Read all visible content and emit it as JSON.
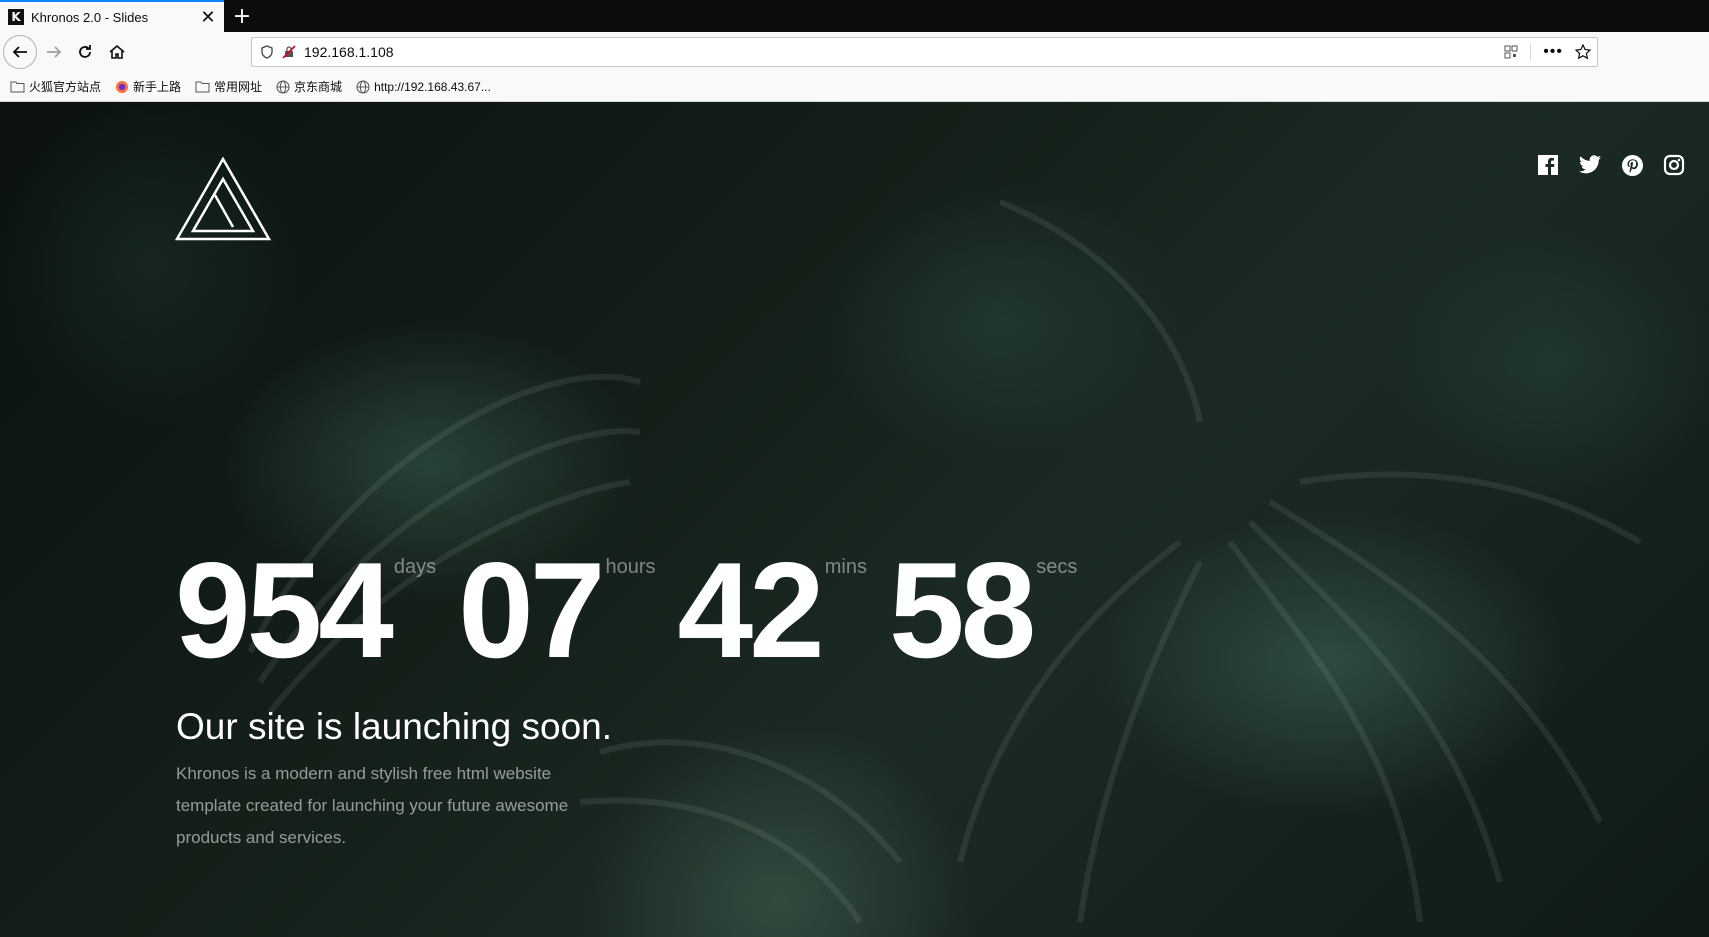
{
  "browser": {
    "tab_title": "Khronos 2.0 - Slides",
    "favicon_letter": "K",
    "url": "192.168.1.108",
    "bookmarks": [
      {
        "label": "火狐官方站点",
        "icon": "folder-icon"
      },
      {
        "label": "新手上路",
        "icon": "firefox-icon"
      },
      {
        "label": "常用网址",
        "icon": "folder-icon"
      },
      {
        "label": "京东商城",
        "icon": "globe-icon"
      },
      {
        "label": "http://192.168.43.67...",
        "icon": "globe-icon"
      }
    ]
  },
  "countdown": [
    {
      "value": "954",
      "label": "days"
    },
    {
      "value": "07",
      "label": "hours"
    },
    {
      "value": "42",
      "label": "mins"
    },
    {
      "value": "58",
      "label": "secs"
    }
  ],
  "headline": "Our site is launching soon.",
  "description": "Khronos is a modern and stylish free html website template created for launching your future awesome products and services.",
  "social": [
    "facebook-icon",
    "twitter-icon",
    "pinterest-icon",
    "instagram-icon"
  ],
  "colors": {
    "accent": "#0a84ff",
    "text": "#ffffff"
  }
}
